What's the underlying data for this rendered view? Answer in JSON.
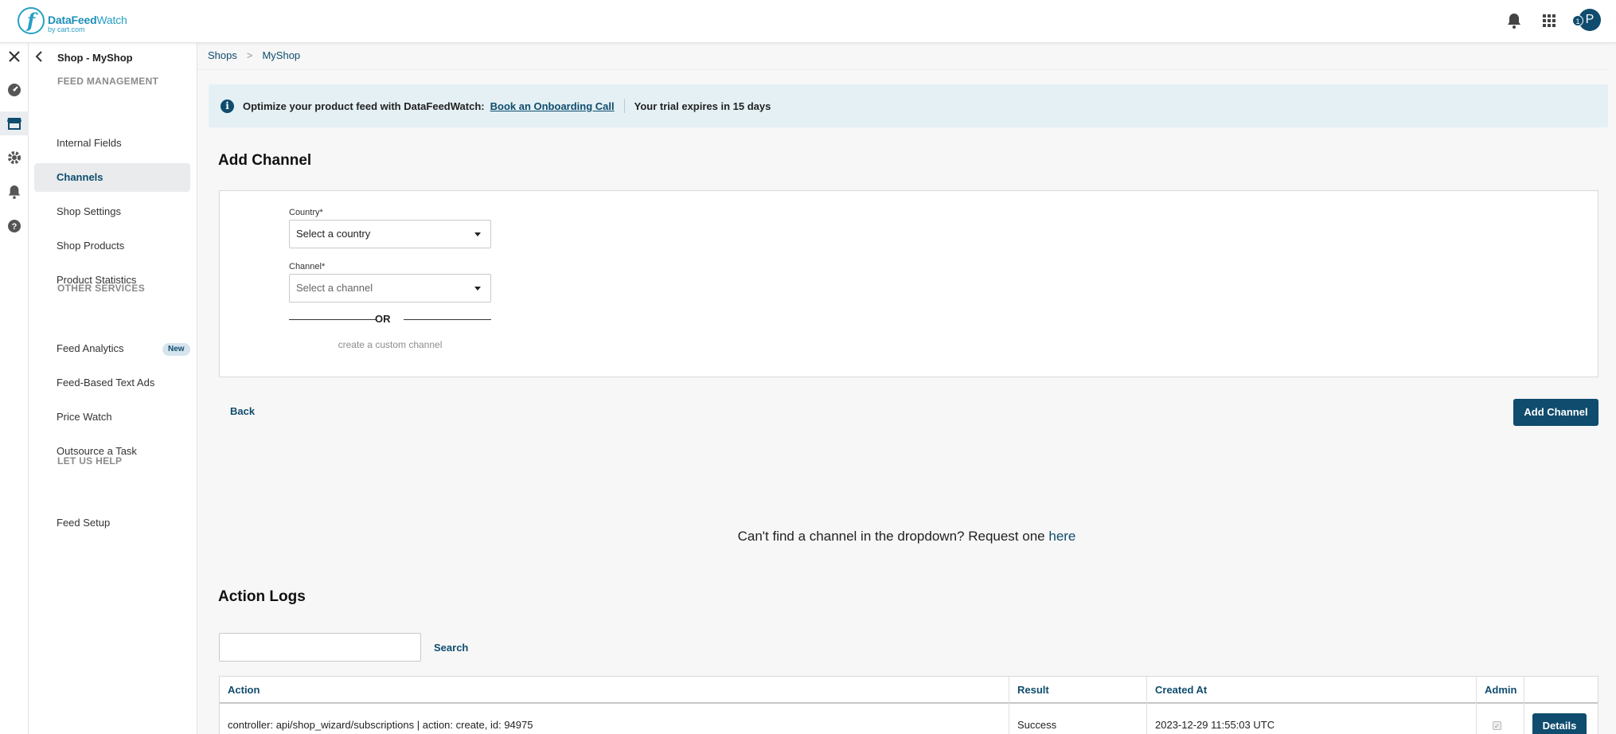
{
  "header": {
    "logo_text_bold": "DataFeed",
    "logo_text_thin": "Watch",
    "logo_sub": "by cart.com",
    "notification_badge": "1",
    "avatar_initial": "P"
  },
  "sidebar": {
    "title": "Shop - MyShop",
    "sections": [
      {
        "label": "FEED MANAGEMENT"
      },
      {
        "label": "OTHER SERVICES"
      },
      {
        "label": "LET US HELP"
      }
    ],
    "items": [
      {
        "label": "Internal Fields"
      },
      {
        "label": "Channels"
      },
      {
        "label": "Shop Settings"
      },
      {
        "label": "Shop Products"
      },
      {
        "label": "Product Statistics"
      },
      {
        "label": "Feed Analytics",
        "badge": "New"
      },
      {
        "label": "Feed-Based Text Ads"
      },
      {
        "label": "Price Watch"
      },
      {
        "label": "Outsource a Task"
      },
      {
        "label": "Feed Setup"
      }
    ]
  },
  "breadcrumb": {
    "items": [
      "Shops",
      "MyShop"
    ],
    "separator": ">"
  },
  "banner": {
    "text": "Optimize your product feed with DataFeedWatch:",
    "link": "Book an Onboarding Call",
    "trial": "Your trial expires in 15 days"
  },
  "add_channel": {
    "title": "Add Channel",
    "country_label": "Country*",
    "country_value": "Select a country",
    "channel_label": "Channel*",
    "channel_value": "Select a channel",
    "or_text": "OR",
    "custom_link": "create a custom channel",
    "back_label": "Back",
    "submit_label": "Add Channel"
  },
  "request": {
    "text": "Can't find a channel in the dropdown? Request one",
    "link": "here"
  },
  "action_logs": {
    "title": "Action Logs",
    "search_label": "Search",
    "columns": [
      "Action",
      "Result",
      "Created At",
      "Admin",
      ""
    ],
    "rows": [
      {
        "action": "controller: api/shop_wizard/subscriptions | action: create, id: 94975",
        "result": "Success",
        "created_at": "2023-12-29 11:55:03 UTC",
        "details_label": "Details"
      }
    ]
  }
}
